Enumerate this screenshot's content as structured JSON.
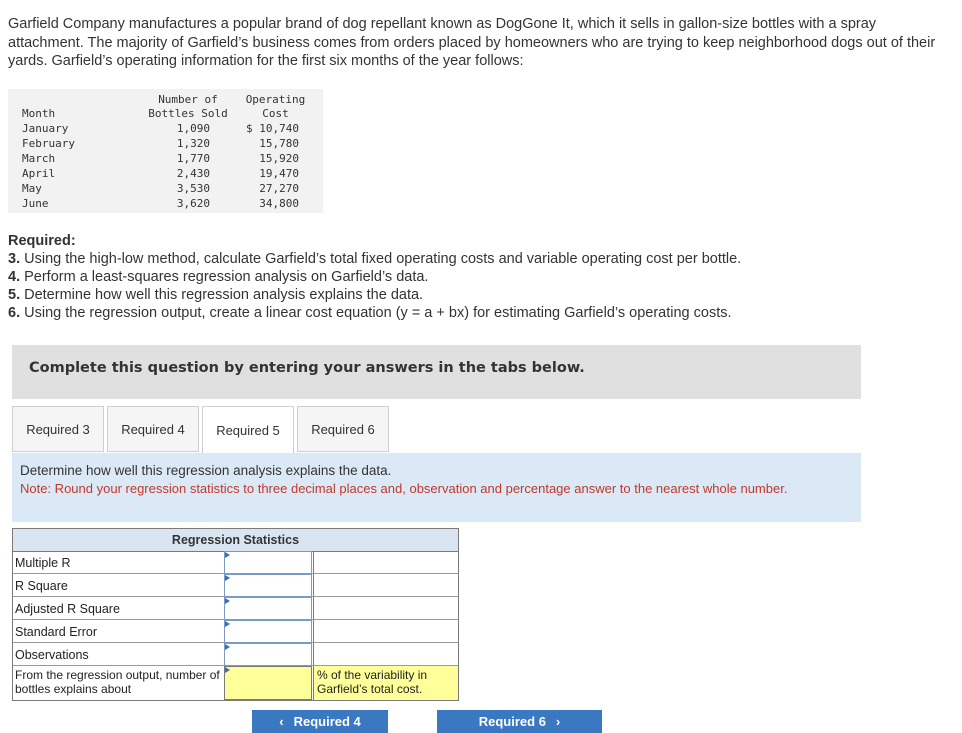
{
  "intro": "Garfield Company manufactures a popular brand of dog repellant known as DogGone It, which it sells in gallon-size bottles with a spray attachment. The majority of Garfield’s business comes from orders placed by homeowners who are trying to keep neighborhood dogs out of their yards. Garfield’s operating information for the first six months of the year follows:",
  "op_table": {
    "headers": {
      "month": "Month",
      "bottles": "Number of\nBottles Sold",
      "cost": "Operating\nCost"
    },
    "rows": [
      {
        "month": "January",
        "bottles": "1,090",
        "cost": "$ 10,740"
      },
      {
        "month": "February",
        "bottles": "1,320",
        "cost": "15,780"
      },
      {
        "month": "March",
        "bottles": "1,770",
        "cost": "15,920"
      },
      {
        "month": "April",
        "bottles": "2,430",
        "cost": "19,470"
      },
      {
        "month": "May",
        "bottles": "3,530",
        "cost": "27,270"
      },
      {
        "month": "June",
        "bottles": "3,620",
        "cost": "34,800"
      }
    ]
  },
  "required": {
    "title": "Required:",
    "items": [
      {
        "num": "3.",
        "text": " Using the high-low method, calculate Garfield’s total fixed operating costs and variable operating cost per bottle."
      },
      {
        "num": "4.",
        "text": " Perform a least-squares regression analysis on Garfield’s data."
      },
      {
        "num": "5.",
        "text": " Determine how well this regression analysis explains the data."
      },
      {
        "num": "6.",
        "text": " Using the regression output, create a linear cost equation (y = a + bx) for estimating Garfield’s operating costs."
      }
    ]
  },
  "complete_text": "Complete this question by entering your answers in the tabs below.",
  "tabs": [
    "Required 3",
    "Required 4",
    "Required 5",
    "Required 6"
  ],
  "active_tab": "Required 5",
  "prompt": {
    "line1": "Determine how well this regression analysis explains the data.",
    "line2": "Note: Round your regression statistics to three decimal places and, observation and percentage answer to the nearest whole number."
  },
  "reg_table": {
    "title": "Regression Statistics",
    "rows": [
      "Multiple R",
      "R Square",
      "Adjusted R Square",
      "Standard Error",
      "Observations"
    ],
    "last_label": "From the regression output, number of bottles explains about",
    "last_suffix": "% of the variability in Garfield’s total cost."
  },
  "nav": {
    "prev": "Required 4",
    "next": "Required 6",
    "prev_icon": "chevron-left-icon",
    "next_icon": "chevron-right-icon"
  },
  "colors": {
    "note": "#c0392b",
    "prompt_bg": "#dbe9f6",
    "answer_bg": "#ffff99",
    "nav_bg": "#3a78c2"
  }
}
